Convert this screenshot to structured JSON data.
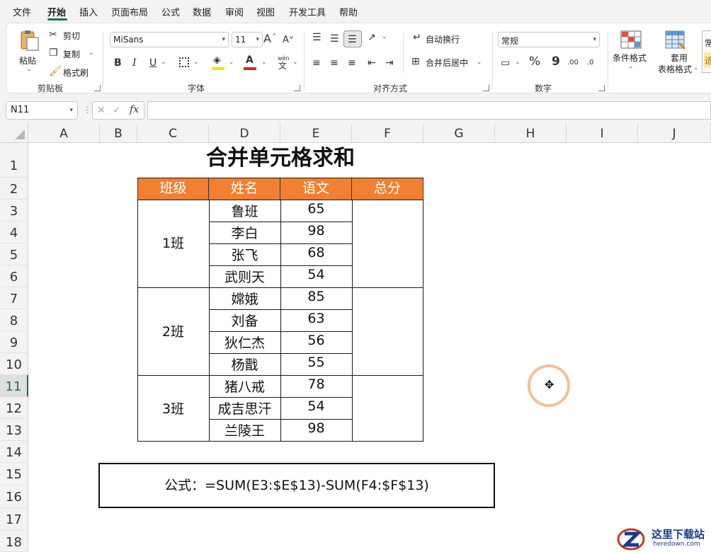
{
  "menu": {
    "items": [
      "文件",
      "开始",
      "插入",
      "页面布局",
      "公式",
      "数据",
      "审阅",
      "视图",
      "开发工具",
      "帮助"
    ],
    "active_index": 1
  },
  "ribbon": {
    "clipboard": {
      "paste_label": "粘贴",
      "cut_label": "剪切",
      "copy_label": "复制",
      "format_painter_label": "格式刷",
      "group_label": "剪贴板"
    },
    "font": {
      "font_name": "MiSans",
      "font_size": "11",
      "grow_label": "A",
      "shrink_label": "A",
      "bold_label": "B",
      "italic_label": "I",
      "underline_label": "U",
      "phonetic_label": "wén",
      "phonetic_char": "文",
      "group_label": "字体"
    },
    "alignment": {
      "wrap_text_label": "自动换行",
      "merge_center_label": "合并后居中",
      "group_label": "对齐方式"
    },
    "number": {
      "format_value": "常规",
      "percent_label": "%",
      "comma_label": "9",
      "increase_decimal_label": ".00",
      "decrease_decimal_label": ".0",
      "group_label": "数字"
    },
    "styles": {
      "conditional_label": "条件格式",
      "table_format_label_1": "套用",
      "table_format_label_2": "表格格式",
      "partial_1": "常",
      "partial_2": "适"
    }
  },
  "formula_bar": {
    "name_box": "N11",
    "fx_label": "fx",
    "formula": ""
  },
  "sheet": {
    "columns": [
      "A",
      "B",
      "C",
      "D",
      "E",
      "F",
      "G",
      "H",
      "I",
      "J"
    ],
    "rows": [
      "1",
      "2",
      "3",
      "4",
      "5",
      "6",
      "7",
      "8",
      "9",
      "10",
      "11",
      "12",
      "13",
      "14",
      "15",
      "16",
      "17",
      "18"
    ],
    "active_row": "11",
    "title": "合并单元格求和",
    "headers": [
      "班级",
      "姓名",
      "语文",
      "总分"
    ],
    "classes": [
      "1班",
      "2班",
      "3班"
    ],
    "names": [
      "鲁班",
      "李白",
      "张飞",
      "武则天",
      "嫦娥",
      "刘备",
      "狄仁杰",
      "杨戬",
      "猪八戒",
      "成吉思汗",
      "兰陵王"
    ],
    "scores": [
      "65",
      "98",
      "68",
      "54",
      "85",
      "63",
      "56",
      "55",
      "78",
      "54",
      "98"
    ],
    "formula_note": "公式：=SUM(E3:$E$13)-SUM(F4:$F$13)",
    "cursor_glyph": "✥"
  },
  "colors": {
    "header_fill": "#f28030",
    "header_text": "#ffffff",
    "accent": "#1e7145",
    "cursor_ring": "#f2c09a"
  },
  "watermark": {
    "title": "这里下载站",
    "url": "heredown.com"
  }
}
